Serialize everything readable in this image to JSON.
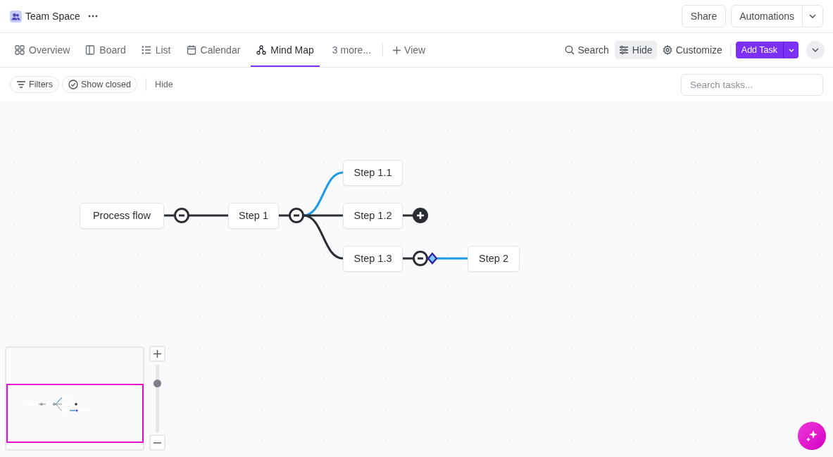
{
  "header": {
    "title": "Team Space",
    "buttons": [
      "Share",
      "Automations"
    ]
  },
  "tabs": [
    {
      "label": "Overview",
      "selected": false
    },
    {
      "label": "Board",
      "selected": false
    },
    {
      "label": "List",
      "selected": false
    },
    {
      "label": "Calendar",
      "selected": false
    },
    {
      "label": "Mind Map",
      "selected": true
    }
  ],
  "more_tabs": "3 more...",
  "add_view": "View",
  "toolbar": [
    {
      "label": "Search",
      "selected": false
    },
    {
      "label": "Hide",
      "selected": true
    },
    {
      "label": "Customize",
      "selected": false
    }
  ],
  "add_task": "Add Task",
  "filters": {
    "buttons": [
      {
        "label": "Filters"
      },
      {
        "label": "Show closed"
      }
    ],
    "hide": "Hide",
    "search_placeholder": "Search tasks..."
  },
  "mind_map": {
    "label": "Process flow",
    "expanded": true,
    "children": [
      {
        "label": "Step 1",
        "expanded": true,
        "edge_highlighted": false,
        "children": [
          {
            "label": "Step 1.1",
            "edge_highlighted": true
          },
          {
            "label": "Step 1.2",
            "expanded": false,
            "edge_highlighted": false
          },
          {
            "label": "Step 1.3",
            "expanded": true,
            "edge_highlighted": false,
            "children": [
              {
                "label": "Step 2",
                "edge_highlighted": true,
                "edge_selected": true
              }
            ]
          }
        ]
      }
    ]
  },
  "zoom_slider": {
    "level": 0.75
  }
}
